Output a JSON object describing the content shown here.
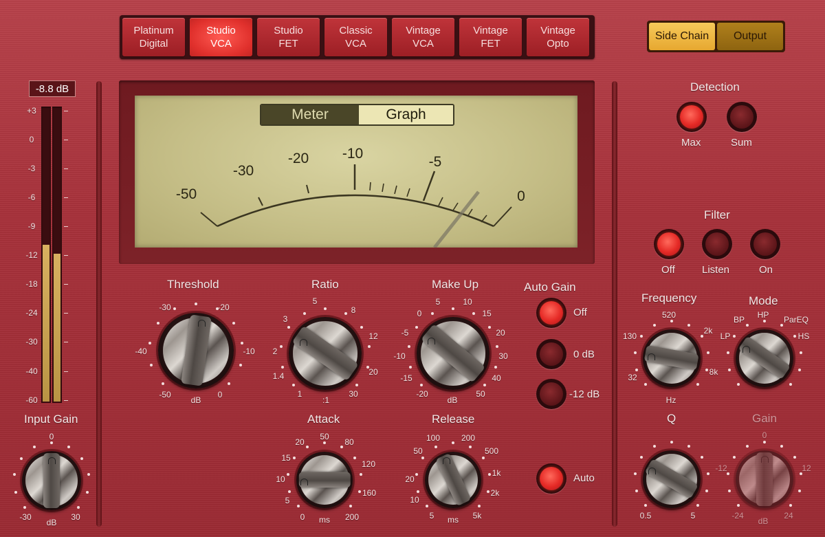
{
  "models": [
    {
      "line1": "Platinum",
      "line2": "Digital",
      "active": false
    },
    {
      "line1": "Studio",
      "line2": "VCA",
      "active": true
    },
    {
      "line1": "Studio",
      "line2": "FET",
      "active": false
    },
    {
      "line1": "Classic",
      "line2": "VCA",
      "active": false
    },
    {
      "line1": "Vintage",
      "line2": "VCA",
      "active": false
    },
    {
      "line1": "Vintage",
      "line2": "FET",
      "active": false
    },
    {
      "line1": "Vintage",
      "line2": "Opto",
      "active": false
    }
  ],
  "view_toggle": {
    "side_chain": "Side Chain",
    "output": "Output",
    "active": "side_chain"
  },
  "meter": {
    "tabs": {
      "meter": "Meter",
      "graph": "Graph",
      "active": "meter"
    },
    "scale": [
      "-50",
      "-30",
      "-20",
      "-10",
      "-5",
      "0"
    ]
  },
  "input_meter": {
    "readout": "-8.8 dB",
    "scale": [
      "+3",
      "0",
      "-3",
      "-6",
      "-9",
      "-12",
      "-18",
      "-24",
      "-30",
      "-40",
      "-60"
    ],
    "level_left": 0.53,
    "level_right": 0.5
  },
  "input_gain": {
    "label": "Input Gain",
    "min": "-30",
    "mid": "0",
    "max": "30",
    "unit": "dB"
  },
  "threshold": {
    "label": "Threshold",
    "ticks": [
      "-30",
      "-20",
      "-40",
      "-10",
      "-50",
      "0"
    ],
    "unit": "dB"
  },
  "ratio": {
    "label": "Ratio",
    "ticks": [
      "5",
      "8",
      "3",
      "12",
      "2",
      "20",
      "1.4",
      "30",
      "1"
    ],
    "unit": ":1"
  },
  "makeup": {
    "label": "Make Up",
    "ticks": [
      "5",
      "10",
      "0",
      "15",
      "-5",
      "20",
      "-10",
      "30",
      "-15",
      "40",
      "-20",
      "50"
    ],
    "unit": "dB"
  },
  "auto_gain": {
    "label": "Auto Gain",
    "options": [
      "Off",
      "0 dB",
      "-12 dB"
    ],
    "active": "Off"
  },
  "attack": {
    "label": "Attack",
    "ticks": [
      "50",
      "20",
      "80",
      "15",
      "120",
      "10",
      "160",
      "5",
      "0",
      "200"
    ],
    "unit": "ms"
  },
  "release": {
    "label": "Release",
    "ticks": [
      "100",
      "200",
      "50",
      "500",
      "1k",
      "20",
      "2k",
      "10",
      "5",
      "5k"
    ],
    "unit": "ms"
  },
  "auto_release": {
    "label": "Auto",
    "on": true
  },
  "detection": {
    "label": "Detection",
    "options": [
      "Max",
      "Sum"
    ],
    "active": "Max"
  },
  "filter": {
    "label": "Filter",
    "options": [
      "Off",
      "Listen",
      "On"
    ],
    "active": "Off"
  },
  "frequency": {
    "label": "Frequency",
    "ticks": [
      "520",
      "130",
      "2k",
      "32",
      "8k"
    ],
    "unit": "Hz"
  },
  "mode": {
    "label": "Mode",
    "ticks": [
      "BP",
      "HP",
      "ParEQ",
      "LP",
      "HS"
    ]
  },
  "q": {
    "label": "Q",
    "min": "0.5",
    "max": "5"
  },
  "gain": {
    "label": "Gain",
    "ticks": [
      "0",
      "-12",
      "12",
      "-24",
      "24"
    ],
    "unit": "dB"
  },
  "colors": {
    "panel": "#a8323b",
    "led_on": "#e52a26",
    "accent": "#e8a838",
    "meter_face": "#d0c992"
  }
}
